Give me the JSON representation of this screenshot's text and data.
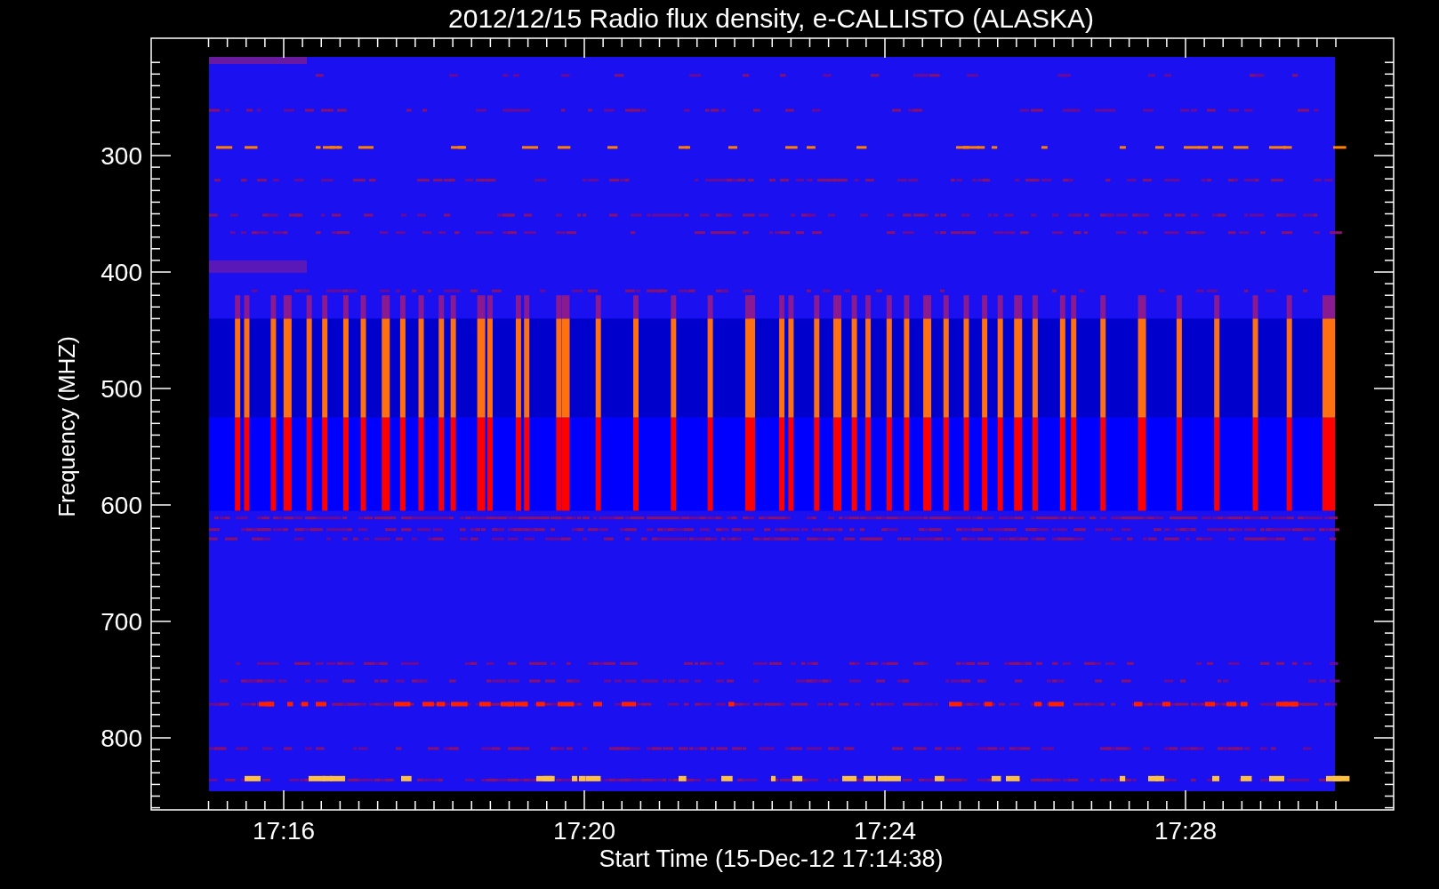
{
  "title": "2012/12/15  Radio flux density, e-CALLISTO (ALASKA)",
  "y_axis": {
    "label": "Frequency (MHZ)",
    "ticks": [
      "300",
      "400",
      "500",
      "600",
      "700",
      "800"
    ]
  },
  "x_axis": {
    "label": "Start Time (15-Dec-12 17:14:38)",
    "ticks": [
      "17:16",
      "17:20",
      "17:24",
      "17:28"
    ]
  }
}
